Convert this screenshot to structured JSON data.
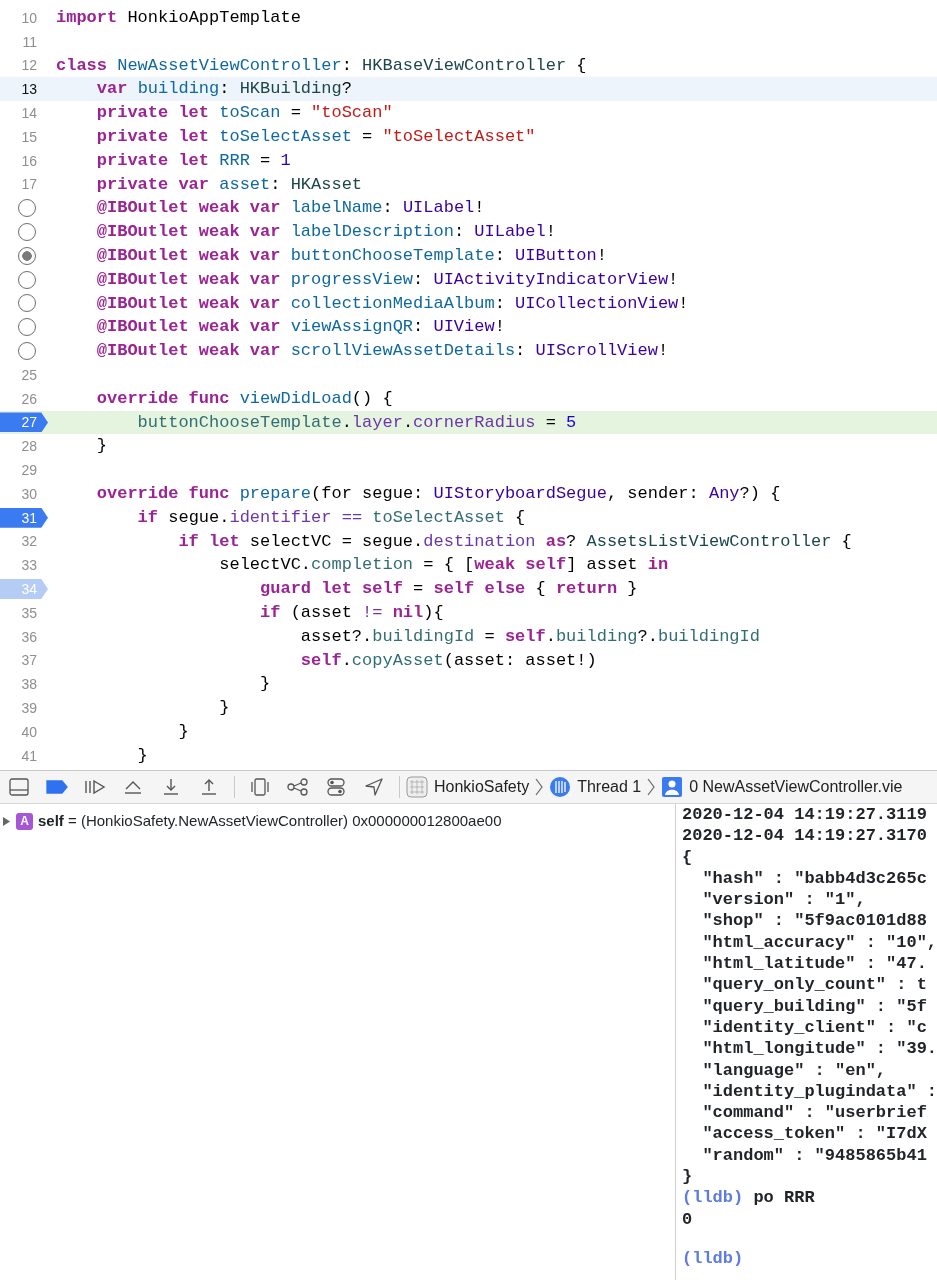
{
  "editor": {
    "lines": [
      {
        "number": "10",
        "current": false,
        "executing": false,
        "breakpoint": false,
        "tokens": [
          {
            "text": "import",
            "kind": "kw"
          },
          {
            "text": " HonkioAppTemplate",
            "kind": "plain"
          }
        ]
      },
      {
        "number": "11",
        "current": false,
        "executing": false,
        "breakpoint": false
      },
      {
        "number": "12",
        "current": false,
        "executing": false,
        "breakpoint": false,
        "tokens": [
          {
            "text": "class ",
            "kind": "kw"
          },
          {
            "text": "NewAssetViewController",
            "kind": "decl"
          },
          {
            "text": ": ",
            "kind": "plain"
          },
          {
            "text": "HKBaseViewController",
            "kind": "proj_type"
          },
          {
            "text": " {",
            "kind": "plain"
          }
        ]
      },
      {
        "number": "13",
        "current": true,
        "executing": false,
        "breakpoint": false,
        "tokens": [
          {
            "text": "    var ",
            "kind": "kw"
          },
          {
            "text": "building",
            "kind": "decl"
          },
          {
            "text": ": ",
            "kind": "plain"
          },
          {
            "text": "HKBuilding",
            "kind": "proj_type"
          },
          {
            "text": "?",
            "kind": "plain"
          }
        ]
      },
      {
        "number": "14",
        "current": false,
        "executing": false,
        "breakpoint": false,
        "tokens": [
          {
            "text": "    private let ",
            "kind": "kw"
          },
          {
            "text": "toScan",
            "kind": "decl"
          },
          {
            "text": " = ",
            "kind": "plain"
          },
          {
            "text": "\"toScan\"",
            "kind": "str"
          }
        ]
      },
      {
        "number": "15",
        "current": false,
        "executing": false,
        "breakpoint": false,
        "tokens": [
          {
            "text": "    private let ",
            "kind": "kw"
          },
          {
            "text": "toSelectAsset",
            "kind": "decl"
          },
          {
            "text": " = ",
            "kind": "plain"
          },
          {
            "text": "\"toSelectAsset\"",
            "kind": "str"
          }
        ]
      },
      {
        "number": "16",
        "current": false,
        "executing": false,
        "breakpoint": false,
        "tokens": [
          {
            "text": "    private let ",
            "kind": "kw"
          },
          {
            "text": "RRR",
            "kind": "decl"
          },
          {
            "text": " = ",
            "kind": "plain"
          },
          {
            "text": "1",
            "kind": "num"
          }
        ]
      },
      {
        "number": "17",
        "current": false,
        "executing": false,
        "breakpoint": false,
        "tokens": [
          {
            "text": "    private var ",
            "kind": "kw"
          },
          {
            "text": "asset",
            "kind": "decl"
          },
          {
            "text": ": ",
            "kind": "plain"
          },
          {
            "text": "HKAsset",
            "kind": "proj_type"
          }
        ]
      },
      {
        "outlet_connected": false,
        "current": false,
        "executing": false,
        "tokens": [
          {
            "text": "    @IBOutlet weak var ",
            "kind": "kw"
          },
          {
            "text": "labelName",
            "kind": "decl"
          },
          {
            "text": ": ",
            "kind": "plain"
          },
          {
            "text": "UILabel",
            "kind": "sys_type"
          },
          {
            "text": "!",
            "kind": "plain"
          }
        ]
      },
      {
        "outlet_connected": false,
        "current": false,
        "executing": false,
        "tokens": [
          {
            "text": "    @IBOutlet weak var ",
            "kind": "kw"
          },
          {
            "text": "labelDescription",
            "kind": "decl"
          },
          {
            "text": ": ",
            "kind": "plain"
          },
          {
            "text": "UILabel",
            "kind": "sys_type"
          },
          {
            "text": "!",
            "kind": "plain"
          }
        ]
      },
      {
        "outlet_connected": true,
        "current": false,
        "executing": false,
        "tokens": [
          {
            "text": "    @IBOutlet weak var ",
            "kind": "kw"
          },
          {
            "text": "buttonChooseTemplate",
            "kind": "decl"
          },
          {
            "text": ": ",
            "kind": "plain"
          },
          {
            "text": "UIButton",
            "kind": "sys_type"
          },
          {
            "text": "!",
            "kind": "plain"
          }
        ]
      },
      {
        "outlet_connected": false,
        "current": false,
        "executing": false,
        "tokens": [
          {
            "text": "    @IBOutlet weak var ",
            "kind": "kw"
          },
          {
            "text": "progressView",
            "kind": "decl"
          },
          {
            "text": ": ",
            "kind": "plain"
          },
          {
            "text": "UIActivityIndicatorView",
            "kind": "sys_type"
          },
          {
            "text": "!",
            "kind": "plain"
          }
        ]
      },
      {
        "outlet_connected": false,
        "current": false,
        "executing": false,
        "tokens": [
          {
            "text": "    @IBOutlet weak var ",
            "kind": "kw"
          },
          {
            "text": "collectionMediaAlbum",
            "kind": "decl"
          },
          {
            "text": ": ",
            "kind": "plain"
          },
          {
            "text": "UICollectionView",
            "kind": "sys_type"
          },
          {
            "text": "!",
            "kind": "plain"
          }
        ]
      },
      {
        "outlet_connected": false,
        "current": false,
        "executing": false,
        "tokens": [
          {
            "text": "    @IBOutlet weak var ",
            "kind": "kw"
          },
          {
            "text": "viewAssignQR",
            "kind": "decl"
          },
          {
            "text": ": ",
            "kind": "plain"
          },
          {
            "text": "UIView",
            "kind": "sys_type"
          },
          {
            "text": "!",
            "kind": "plain"
          }
        ]
      },
      {
        "outlet_connected": false,
        "current": false,
        "executing": false,
        "tokens": [
          {
            "text": "    @IBOutlet weak var ",
            "kind": "kw"
          },
          {
            "text": "scrollViewAssetDetails",
            "kind": "decl"
          },
          {
            "text": ": ",
            "kind": "plain"
          },
          {
            "text": "UIScrollView",
            "kind": "sys_type"
          },
          {
            "text": "!",
            "kind": "plain"
          }
        ]
      },
      {
        "number": "25",
        "current": false,
        "executing": false,
        "breakpoint": false
      },
      {
        "number": "26",
        "current": false,
        "executing": false,
        "breakpoint": false,
        "tokens": [
          {
            "text": "    override func ",
            "kind": "kw"
          },
          {
            "text": "viewDidLoad",
            "kind": "decl"
          },
          {
            "text": "() {",
            "kind": "plain"
          }
        ]
      },
      {
        "number": "27",
        "current": false,
        "executing": true,
        "breakpoint": true,
        "breakpoint_enabled": true,
        "tokens": [
          {
            "text": "        buttonChooseTemplate",
            "kind": "proj_prop"
          },
          {
            "text": ".",
            "kind": "plain"
          },
          {
            "text": "layer",
            "kind": "sys_prop"
          },
          {
            "text": ".",
            "kind": "plain"
          },
          {
            "text": "cornerRadius",
            "kind": "sys_prop"
          },
          {
            "text": " = ",
            "kind": "plain"
          },
          {
            "text": "5",
            "kind": "num"
          }
        ]
      },
      {
        "number": "28",
        "current": false,
        "executing": false,
        "breakpoint": false,
        "tokens": [
          {
            "text": "    }",
            "kind": "plain"
          }
        ]
      },
      {
        "number": "29",
        "current": false,
        "executing": false,
        "breakpoint": false
      },
      {
        "number": "30",
        "current": false,
        "executing": false,
        "breakpoint": false,
        "tokens": [
          {
            "text": "    override func ",
            "kind": "kw"
          },
          {
            "text": "prepare",
            "kind": "decl"
          },
          {
            "text": "(for segue: ",
            "kind": "plain"
          },
          {
            "text": "UIStoryboardSegue",
            "kind": "sys_type"
          },
          {
            "text": ", sender: ",
            "kind": "plain"
          },
          {
            "text": "Any",
            "kind": "sys_type"
          },
          {
            "text": "?) {",
            "kind": "plain"
          }
        ]
      },
      {
        "number": "31",
        "current": false,
        "executing": false,
        "breakpoint": true,
        "breakpoint_enabled": true,
        "tokens": [
          {
            "text": "        if",
            "kind": "kw"
          },
          {
            "text": " segue.",
            "kind": "plain"
          },
          {
            "text": "identifier",
            "kind": "sys_prop"
          },
          {
            "text": " == ",
            "kind": "sys_prop"
          },
          {
            "text": "toSelectAsset",
            "kind": "proj_prop"
          },
          {
            "text": " {",
            "kind": "plain"
          }
        ]
      },
      {
        "number": "32",
        "current": false,
        "executing": false,
        "breakpoint": false,
        "tokens": [
          {
            "text": "            if let",
            "kind": "kw"
          },
          {
            "text": " selectVC = segue.",
            "kind": "plain"
          },
          {
            "text": "destination",
            "kind": "sys_prop"
          },
          {
            "text": " as",
            "kind": "kw"
          },
          {
            "text": "? ",
            "kind": "plain"
          },
          {
            "text": "AssetsListViewController",
            "kind": "proj_type"
          },
          {
            "text": " {",
            "kind": "plain"
          }
        ]
      },
      {
        "number": "33",
        "current": false,
        "executing": false,
        "breakpoint": false,
        "tokens": [
          {
            "text": "                selectVC.",
            "kind": "plain"
          },
          {
            "text": "completion",
            "kind": "proj_prop"
          },
          {
            "text": " = { [",
            "kind": "plain"
          },
          {
            "text": "weak self",
            "kind": "kw"
          },
          {
            "text": "] asset ",
            "kind": "plain"
          },
          {
            "text": "in",
            "kind": "kw"
          }
        ]
      },
      {
        "number": "34",
        "current": false,
        "executing": false,
        "breakpoint": true,
        "breakpoint_enabled": false,
        "tokens": [
          {
            "text": "                    guard let self",
            "kind": "kw"
          },
          {
            "text": " = ",
            "kind": "plain"
          },
          {
            "text": "self else",
            "kind": "kw"
          },
          {
            "text": " { ",
            "kind": "plain"
          },
          {
            "text": "return",
            "kind": "kw"
          },
          {
            "text": " }",
            "kind": "plain"
          }
        ]
      },
      {
        "number": "35",
        "current": false,
        "executing": false,
        "breakpoint": false,
        "tokens": [
          {
            "text": "                    if",
            "kind": "kw"
          },
          {
            "text": " (asset",
            "kind": "plain"
          },
          {
            "text": " != ",
            "kind": "sys_prop"
          },
          {
            "text": "nil",
            "kind": "kw"
          },
          {
            "text": "){",
            "kind": "plain"
          }
        ]
      },
      {
        "number": "36",
        "current": false,
        "executing": false,
        "breakpoint": false,
        "tokens": [
          {
            "text": "                        asset?.",
            "kind": "plain"
          },
          {
            "text": "buildingId",
            "kind": "proj_prop"
          },
          {
            "text": " = ",
            "kind": "plain"
          },
          {
            "text": "self",
            "kind": "kw"
          },
          {
            "text": ".",
            "kind": "plain"
          },
          {
            "text": "building",
            "kind": "proj_prop"
          },
          {
            "text": "?.",
            "kind": "plain"
          },
          {
            "text": "buildingId",
            "kind": "proj_prop"
          }
        ]
      },
      {
        "number": "37",
        "current": false,
        "executing": false,
        "breakpoint": false,
        "tokens": [
          {
            "text": "                        self",
            "kind": "kw"
          },
          {
            "text": ".",
            "kind": "plain"
          },
          {
            "text": "copyAsset",
            "kind": "proj_prop"
          },
          {
            "text": "(asset: asset!)",
            "kind": "plain"
          }
        ]
      },
      {
        "number": "38",
        "current": false,
        "executing": false,
        "breakpoint": false,
        "tokens": [
          {
            "text": "                    }",
            "kind": "plain"
          }
        ]
      },
      {
        "number": "39",
        "current": false,
        "executing": false,
        "breakpoint": false,
        "tokens": [
          {
            "text": "                }",
            "kind": "plain"
          }
        ]
      },
      {
        "number": "40",
        "current": false,
        "executing": false,
        "breakpoint": false,
        "tokens": [
          {
            "text": "            }",
            "kind": "plain"
          }
        ]
      },
      {
        "number": "41",
        "current": false,
        "executing": false,
        "breakpoint": false,
        "tokens": [
          {
            "text": "        }",
            "kind": "plain"
          }
        ]
      }
    ]
  },
  "debug_bar": {
    "breakpoints_active": true,
    "breadcrumbs": [
      {
        "kind": "app",
        "label": "HonkioSafety"
      },
      {
        "kind": "thread",
        "label": "Thread 1"
      },
      {
        "kind": "frame",
        "label": "0 NewAssetViewController.vie"
      }
    ]
  },
  "variables": [
    {
      "expanded": false,
      "badge": "A",
      "text": "**self** = (HonkioSafety.NewAssetViewController) 0x000000012800ae00"
    }
  ],
  "console": [
    {
      "kind": "output",
      "text": "2020-12-04 14:19:27.3119"
    },
    {
      "kind": "output",
      "text": "2020-12-04 14:19:27.3170"
    },
    {
      "kind": "output",
      "text": "{"
    },
    {
      "kind": "output",
      "text": "  \"hash\" : \"babb4d3c265c"
    },
    {
      "kind": "output",
      "text": "  \"version\" : \"1\","
    },
    {
      "kind": "output",
      "text": "  \"shop\" : \"5f9ac0101d88"
    },
    {
      "kind": "output",
      "text": "  \"html_accuracy\" : \"10\","
    },
    {
      "kind": "output",
      "text": "  \"html_latitude\" : \"47."
    },
    {
      "kind": "output",
      "text": "  \"query_only_count\" : t"
    },
    {
      "kind": "output",
      "text": "  \"query_building\" : \"5f"
    },
    {
      "kind": "output",
      "text": "  \"identity_client\" : \"c"
    },
    {
      "kind": "output",
      "text": "  \"html_longitude\" : \"39."
    },
    {
      "kind": "output",
      "text": "  \"language\" : \"en\","
    },
    {
      "kind": "output",
      "text": "  \"identity_plugindata\" :"
    },
    {
      "kind": "output",
      "text": "  \"command\" : \"userbrief"
    },
    {
      "kind": "output",
      "text": "  \"access_token\" : \"I7dX"
    },
    {
      "kind": "output",
      "text": "  \"random\" : \"9485865b41"
    },
    {
      "kind": "output",
      "text": "}"
    },
    {
      "kind": "prompt",
      "prompt": "(lldb)",
      "text": "po RRR",
      "gap_before": false
    },
    {
      "kind": "output",
      "text": "0"
    },
    {
      "kind": "prompt",
      "prompt": "(lldb)",
      "gap_before": true
    }
  ]
}
